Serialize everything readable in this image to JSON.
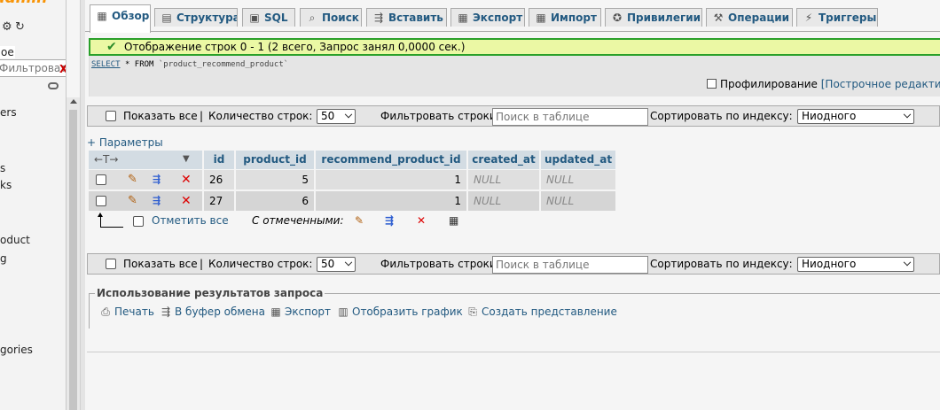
{
  "sidebar": {
    "logo_text": "admin",
    "db_selected": "oe",
    "filter_placeholder": "Фильтровать",
    "clear_label": "X",
    "items": [
      "ers",
      "s",
      "ks",
      "oduct",
      "g",
      "gories"
    ]
  },
  "tabs": [
    {
      "label": "Обзор",
      "icon": "table-icon",
      "active": true
    },
    {
      "label": "Структура",
      "icon": "structure-icon"
    },
    {
      "label": "SQL",
      "icon": "sql-icon"
    },
    {
      "label": "Поиск",
      "icon": "search-icon"
    },
    {
      "label": "Вставить",
      "icon": "insert-icon"
    },
    {
      "label": "Экспорт",
      "icon": "export-icon"
    },
    {
      "label": "Импорт",
      "icon": "import-icon"
    },
    {
      "label": "Привилегии",
      "icon": "privileges-icon"
    },
    {
      "label": "Операции",
      "icon": "operations-icon"
    },
    {
      "label": "Триггеры",
      "icon": "triggers-icon"
    }
  ],
  "success": {
    "message": "Отображение строк 0 - 1 (2 всего, Запрос занял 0,0000 сек.)"
  },
  "query": {
    "kw_select": "SELECT",
    "star": "*",
    "kw_from": "FROM",
    "table": "`product_recommend_product`",
    "profiling_label": "Профилирование",
    "inline_edit_label": "[Построчное редактиро"
  },
  "navbar": {
    "show_all": "Показать все",
    "sep": "|",
    "rows_label": "Количество строк:",
    "rows_value": "50",
    "filter_label": "Фильтровать строки:",
    "filter_placeholder": "Поиск в таблице",
    "sort_label": "Сортировать по индексу:",
    "sort_value": "Ниодного"
  },
  "params_label": "+ Параметры",
  "table": {
    "tools_arrows": "←T→",
    "tools_dropdown": "▼",
    "columns": [
      "id",
      "product_id",
      "recommend_product_id",
      "created_at",
      "updated_at"
    ],
    "rows": [
      {
        "id": "26",
        "product_id": "5",
        "recommend_product_id": "1",
        "created_at": "NULL",
        "updated_at": "NULL"
      },
      {
        "id": "27",
        "product_id": "6",
        "recommend_product_id": "1",
        "created_at": "NULL",
        "updated_at": "NULL"
      }
    ]
  },
  "with_selected": {
    "check_all": "Отметить все",
    "label": "С отмеченными:"
  },
  "results_ops": {
    "legend": "Использование результатов запроса",
    "print": "Печать",
    "clipboard": "В буфер обмена",
    "export": "Экспорт",
    "chart": "Отобразить график",
    "view": "Создать представление"
  }
}
